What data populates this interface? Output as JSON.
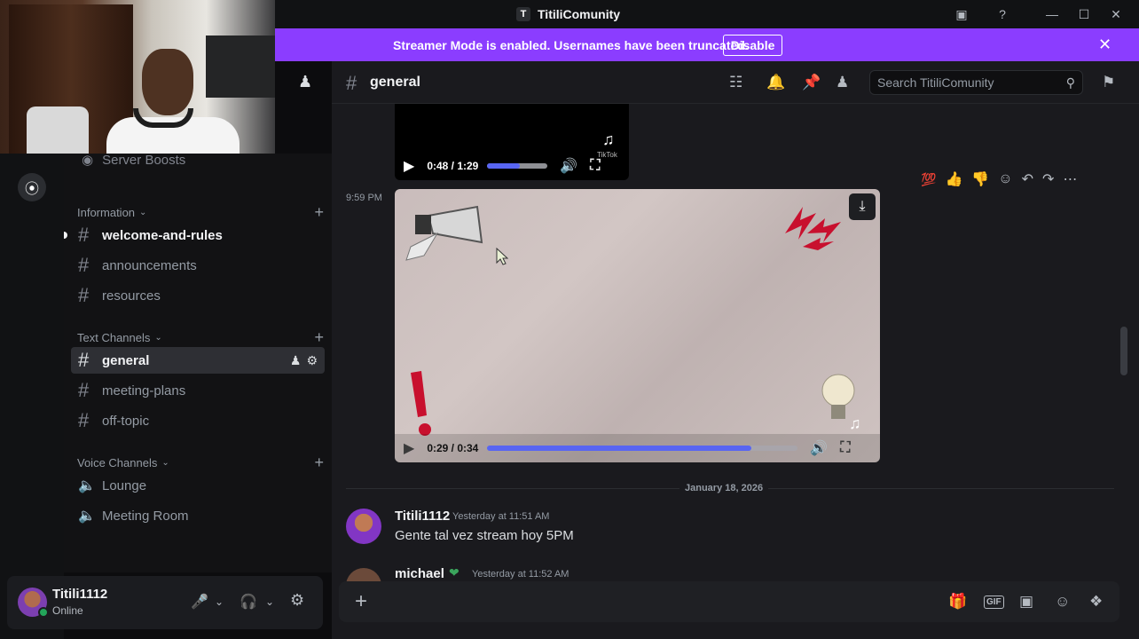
{
  "window": {
    "app_glyph": "T",
    "title": "TitiliComunity",
    "controls": [
      "inbox-icon",
      "help-icon",
      "minimize-icon",
      "maximize-icon",
      "close-icon"
    ]
  },
  "banner": {
    "message": "Streamer Mode is enabled. Usernames have been truncated.",
    "button": "Disable"
  },
  "sidebar": {
    "boosts_label": "Server Boosts",
    "categories": [
      {
        "name": "Information",
        "channels": [
          "welcome-and-rules",
          "announcements",
          "resources"
        ]
      },
      {
        "name": "Text Channels",
        "channels": [
          "general",
          "meeting-plans",
          "off-topic"
        ]
      },
      {
        "name": "Voice Channels",
        "channels": [
          "Lounge",
          "Meeting Room"
        ]
      }
    ],
    "active_channel": "general",
    "unread_channel": "welcome-and-rules"
  },
  "user": {
    "name": "Titili1112",
    "status": "Online"
  },
  "header": {
    "channel": "general",
    "search_placeholder": "Search TitiliComunity"
  },
  "messages": {
    "video1": {
      "time": "0:48 / 1:29",
      "progress": 0.54,
      "watermark": "TikTok"
    },
    "video2_timestamp": "9:59 PM",
    "video2": {
      "time": "0:29 / 0:34",
      "progress": 0.85
    },
    "date_divider": "January 18, 2026",
    "post": {
      "author": "Titili1112",
      "time": "Yesterday at 11:51 AM",
      "text": "Gente tal vez stream hoy 5PM"
    },
    "next": {
      "author": "michael",
      "time": "Yesterday at 11:52 AM"
    }
  },
  "colors": {
    "banner": "#8b3dff",
    "accent": "#5865f2",
    "online": "#23a55a"
  }
}
